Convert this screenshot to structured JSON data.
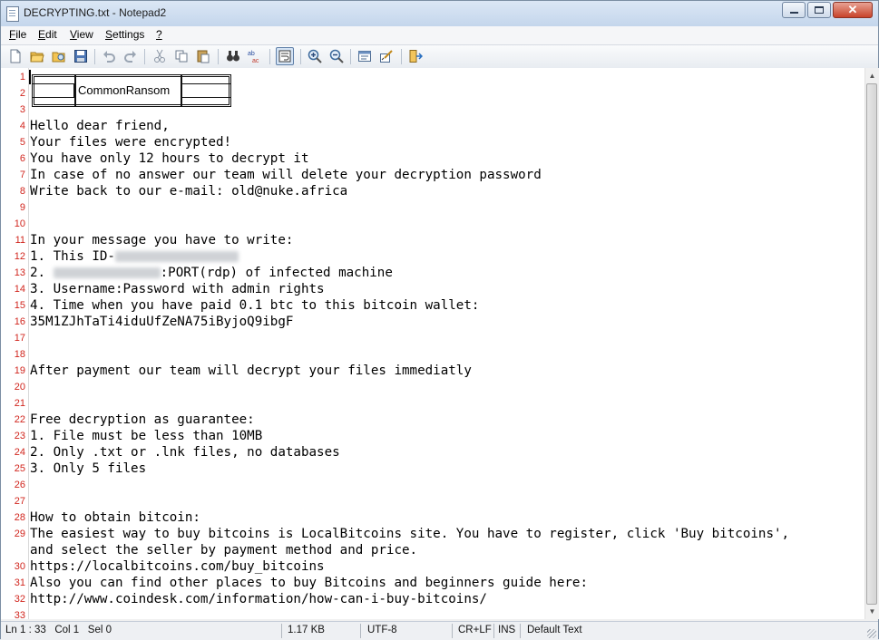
{
  "window": {
    "title": "DECRYPTING.txt - Notepad2"
  },
  "menu": [
    {
      "id": "file",
      "label": "File",
      "u": "F",
      "rest": "ile"
    },
    {
      "id": "edit",
      "label": "Edit",
      "u": "E",
      "rest": "dit"
    },
    {
      "id": "view",
      "label": "View",
      "u": "V",
      "rest": "iew"
    },
    {
      "id": "settings",
      "label": "Settings",
      "u": "S",
      "rest": "ettings"
    },
    {
      "id": "help",
      "label": "?",
      "u": "?",
      "rest": ""
    }
  ],
  "ascii_banner": {
    "label": "CommonRansom"
  },
  "lines": [
    {
      "n": "1",
      "t": ""
    },
    {
      "n": "2",
      "t": ""
    },
    {
      "n": "3",
      "t": ""
    },
    {
      "n": "4",
      "t": "Hello dear friend,"
    },
    {
      "n": "5",
      "t": "Your files were encrypted!"
    },
    {
      "n": "6",
      "t": "You have only 12 hours to decrypt it"
    },
    {
      "n": "7",
      "t": "In case of no answer our team will delete your decryption password"
    },
    {
      "n": "8",
      "t": "Write back to our e-mail: old@nuke.africa"
    },
    {
      "n": "9",
      "t": ""
    },
    {
      "n": "10",
      "t": ""
    },
    {
      "n": "11",
      "t": "In your message you have to write:"
    },
    {
      "n": "12",
      "t": "1. This ID-"
    },
    {
      "n": "13",
      "t": "2. ",
      "after": ":PORT(rdp) of infected machine"
    },
    {
      "n": "14",
      "t": "3. Username:Password with admin rights"
    },
    {
      "n": "15",
      "t": "4. Time when you have paid 0.1 btc to this bitcoin wallet:"
    },
    {
      "n": "16",
      "t": "35M1ZJhTaTi4iduUfZeNA75iByjoQ9ibgF"
    },
    {
      "n": "17",
      "t": ""
    },
    {
      "n": "18",
      "t": ""
    },
    {
      "n": "19",
      "t": "After payment our team will decrypt your files immediatly"
    },
    {
      "n": "20",
      "t": ""
    },
    {
      "n": "21",
      "t": ""
    },
    {
      "n": "22",
      "t": "Free decryption as guarantee:"
    },
    {
      "n": "23",
      "t": "1. File must be less than 10MB"
    },
    {
      "n": "24",
      "t": "2. Only .txt or .lnk files, no databases"
    },
    {
      "n": "25",
      "t": "3. Only 5 files"
    },
    {
      "n": "26",
      "t": ""
    },
    {
      "n": "27",
      "t": ""
    },
    {
      "n": "28",
      "t": "How to obtain bitcoin:"
    },
    {
      "n": "29",
      "t": "The easiest way to buy bitcoins is LocalBitcoins site. You have to register, click 'Buy bitcoins',"
    },
    {
      "n": "",
      "t": "and select the seller by payment method and price."
    },
    {
      "n": "30",
      "t": "https://localbitcoins.com/buy_bitcoins"
    },
    {
      "n": "31",
      "t": "Also you can find other places to buy Bitcoins and beginners guide here:"
    },
    {
      "n": "32",
      "t": "http://www.coindesk.com/information/how-can-i-buy-bitcoins/"
    },
    {
      "n": "33",
      "t": ""
    }
  ],
  "status": {
    "position": "Ln 1 : 33   Col 1   Sel 0",
    "size": "1.17 KB",
    "encoding": "UTF-8",
    "eol": "CR+LF",
    "mode": "INS",
    "scheme": "Default Text"
  }
}
